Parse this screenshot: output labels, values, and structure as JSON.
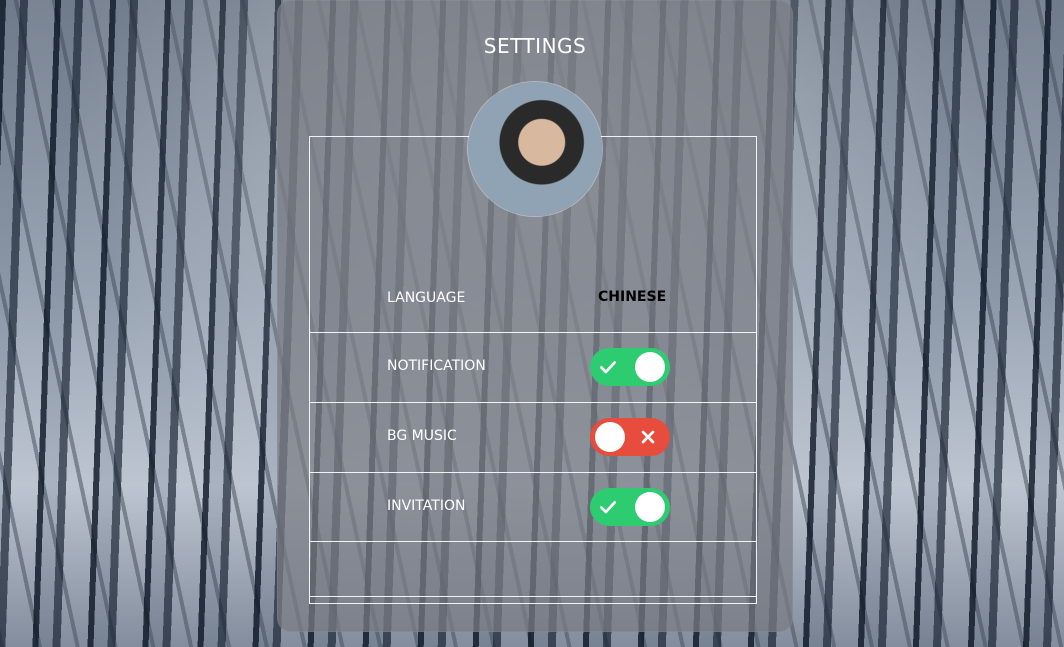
{
  "settings": {
    "title": "SETTINGS",
    "avatar": {
      "alt": "User avatar"
    },
    "rows": {
      "language": {
        "label": "LANGUAGE",
        "value": "CHINESE"
      },
      "notification": {
        "label": "NOTIFICATION",
        "state": "on"
      },
      "bg_music": {
        "label": "BG MUSIC",
        "state": "off"
      },
      "invitation": {
        "label": "INVITATION",
        "state": "on"
      }
    }
  },
  "colors": {
    "toggle_on": "#2ecc71",
    "toggle_off": "#e74c3c"
  },
  "icons": {
    "on": "check-icon",
    "off": "close-icon"
  }
}
